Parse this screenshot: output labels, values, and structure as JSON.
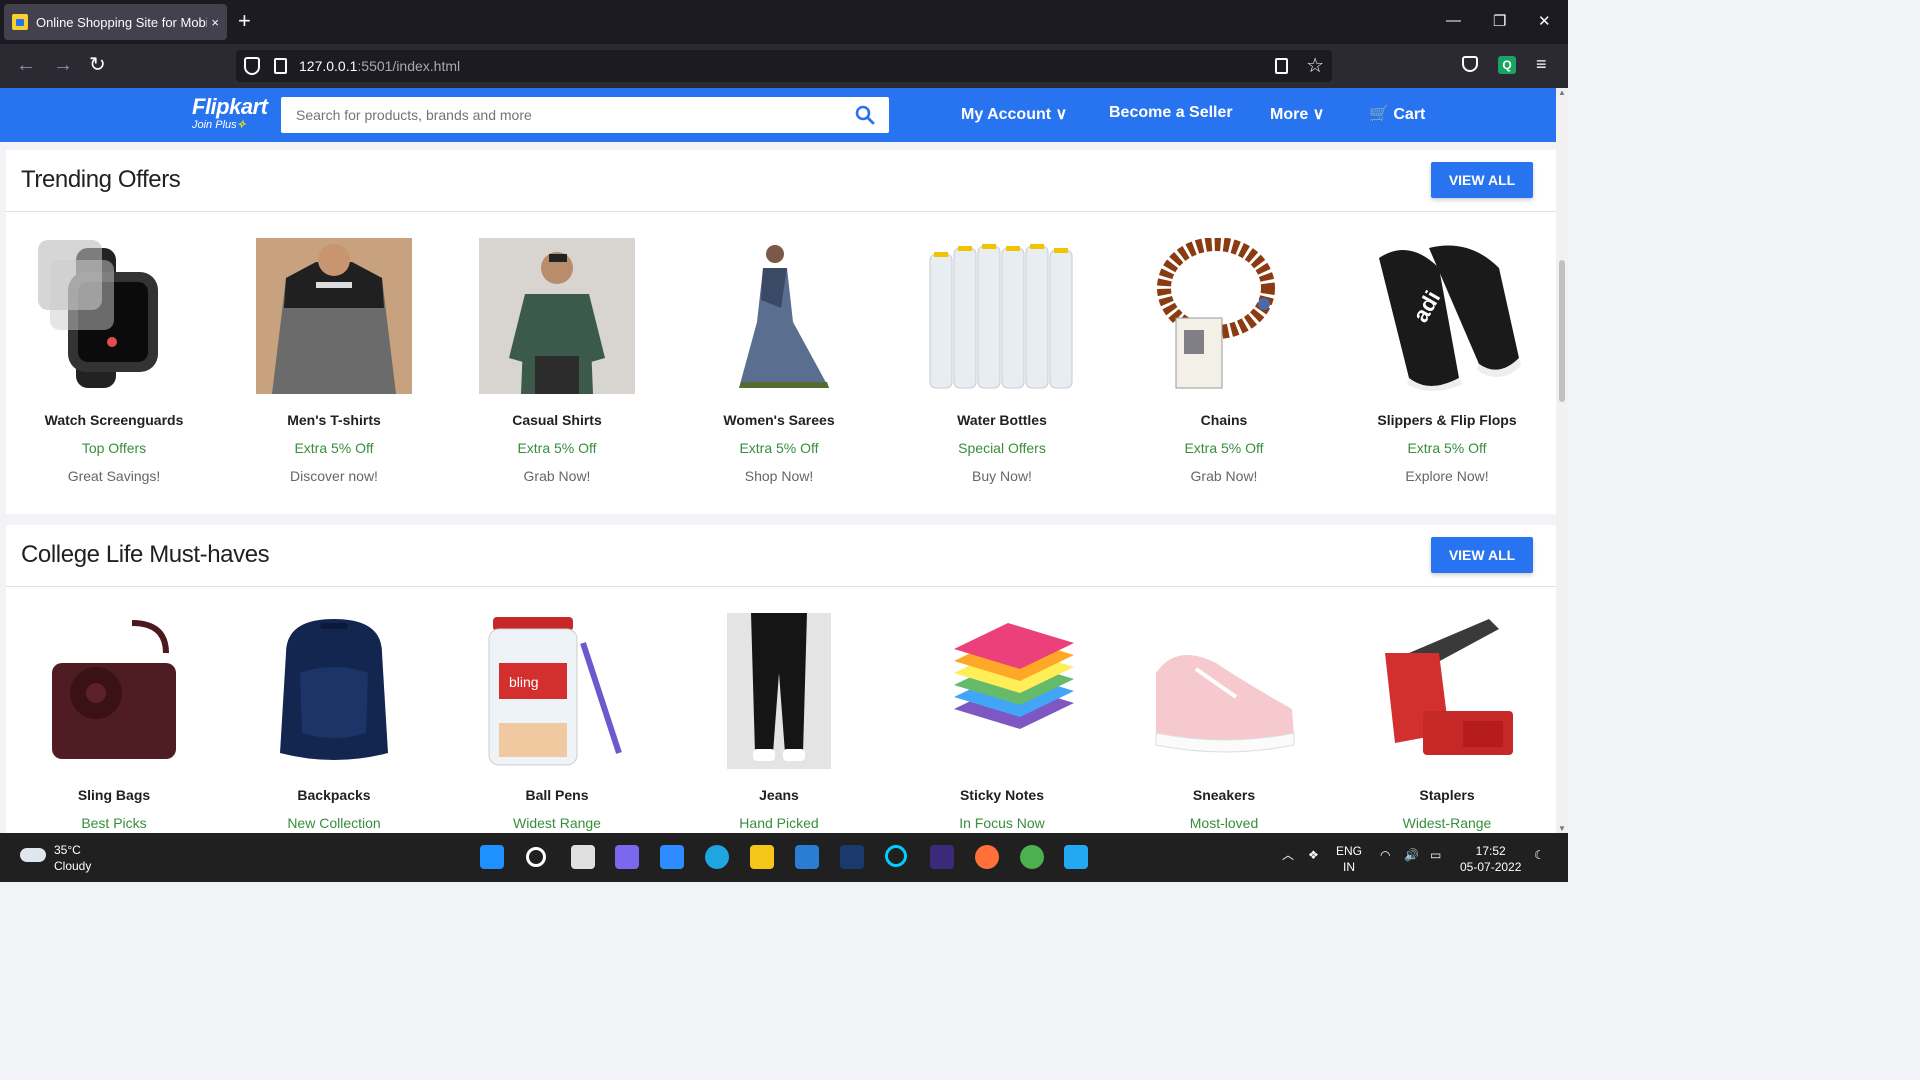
{
  "browser": {
    "tab_title": "Online Shopping Site for Mobile",
    "tab_close": "×",
    "new_tab": "+",
    "url_host": "127.0.0.1",
    "url_path": ":5501/index.html"
  },
  "header": {
    "logo": "Flipkart",
    "logo_sub": "Join Plus",
    "search_placeholder": "Search for products, brands and more",
    "nav": {
      "account": "My Account ∨",
      "seller": "Become a Seller",
      "more": "More ∨",
      "cart": "Cart"
    },
    "brand_color": "#2874f0"
  },
  "sections": [
    {
      "title": "Trending Offers",
      "button": "VIEW ALL",
      "items": [
        {
          "name": "Watch Screenguards",
          "offer": "Top Offers",
          "tag": "Great Savings!",
          "icon": "smartwatch-image"
        },
        {
          "name": "Men's T-shirts",
          "offer": "Extra 5% Off",
          "tag": "Discover now!",
          "icon": "tshirt-image"
        },
        {
          "name": "Casual Shirts",
          "offer": "Extra 5% Off",
          "tag": "Grab Now!",
          "icon": "shirt-image"
        },
        {
          "name": "Women's Sarees",
          "offer": "Extra 5% Off",
          "tag": "Shop Now!",
          "icon": "saree-image"
        },
        {
          "name": "Water Bottles",
          "offer": "Special Offers",
          "tag": "Buy Now!",
          "icon": "bottles-image"
        },
        {
          "name": "Chains",
          "offer": "Extra 5% Off",
          "tag": "Grab Now!",
          "icon": "chain-image"
        },
        {
          "name": "Slippers & Flip Flops",
          "offer": "Extra 5% Off",
          "tag": "Explore Now!",
          "icon": "slippers-image"
        }
      ]
    },
    {
      "title": "College Life Must-haves",
      "button": "VIEW ALL",
      "items": [
        {
          "name": "Sling Bags",
          "offer": "Best Picks",
          "icon": "sling-bag-image"
        },
        {
          "name": "Backpacks",
          "offer": "New Collection",
          "icon": "backpack-image"
        },
        {
          "name": "Ball Pens",
          "offer": "Widest Range",
          "icon": "pens-jar-image"
        },
        {
          "name": "Jeans",
          "offer": "Hand Picked",
          "icon": "jeans-image"
        },
        {
          "name": "Sticky Notes",
          "offer": "In Focus Now",
          "icon": "sticky-notes-image"
        },
        {
          "name": "Sneakers",
          "offer": "Most-loved",
          "icon": "sneaker-image"
        },
        {
          "name": "Staplers",
          "offer": "Widest-Range",
          "icon": "stapler-image"
        }
      ]
    }
  ],
  "taskbar": {
    "temp": "35°C",
    "weather": "Cloudy",
    "lang1": "ENG",
    "lang2": "IN",
    "time": "17:52",
    "date": "05-07-2022"
  }
}
